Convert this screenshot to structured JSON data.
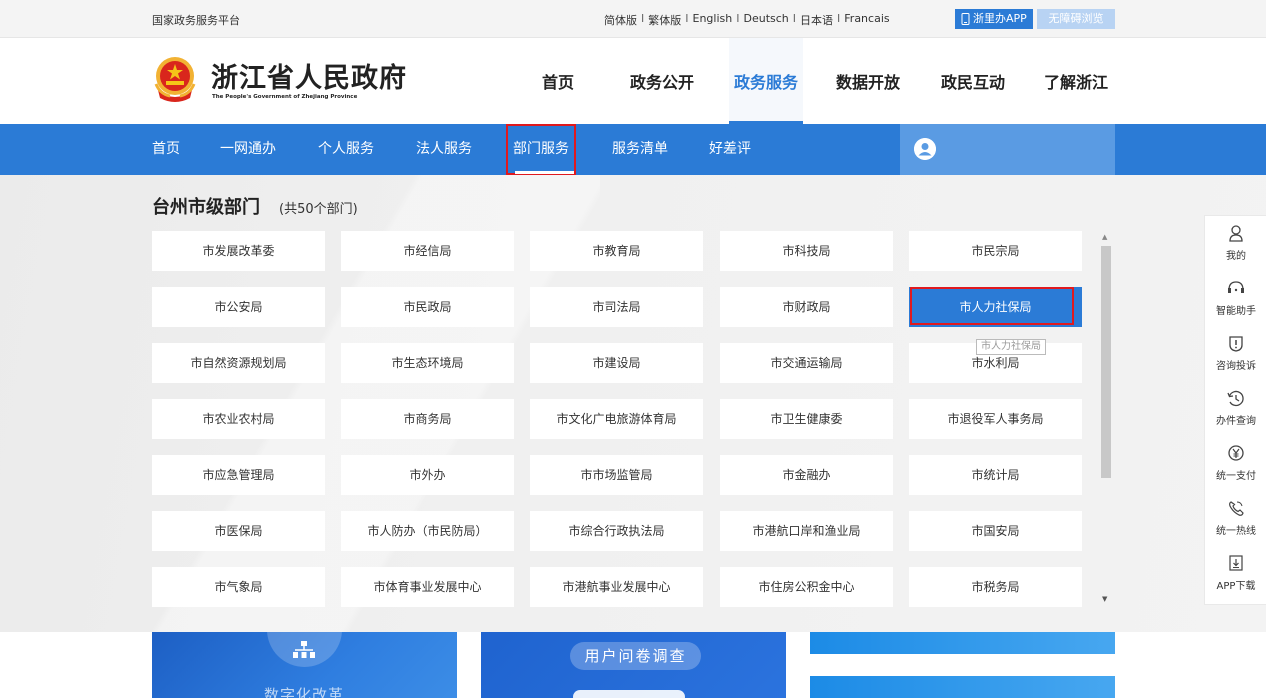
{
  "topbar": {
    "platform": "国家政务服务平台",
    "languages": [
      "简体版",
      "繁体版",
      "English",
      "Deutsch",
      "日本语",
      "Francais"
    ],
    "separator": "I",
    "app_button": "浙里办APP",
    "accessibility_button": "无障碍浏览"
  },
  "header": {
    "logo_cn": "浙江省人民政府",
    "logo_en": "The People's Government of Zhejiang Province",
    "nav": [
      "首页",
      "政务公开",
      "政务服务",
      "数据开放",
      "政民互动",
      "了解浙江"
    ],
    "active_nav": "政务服务"
  },
  "subnav": {
    "items": [
      "首页",
      "一网通办",
      "个人服务",
      "法人服务",
      "部门服务",
      "服务清单",
      "好差评"
    ],
    "highlighted": "部门服务"
  },
  "panel": {
    "title": "台州市级部门",
    "count": "(共50个部门)",
    "departments": [
      [
        "市发展改革委",
        "市经信局",
        "市教育局",
        "市科技局",
        "市民宗局"
      ],
      [
        "市公安局",
        "市民政局",
        "市司法局",
        "市财政局",
        "市人力社保局"
      ],
      [
        "市自然资源规划局",
        "市生态环境局",
        "市建设局",
        "市交通运输局",
        "市水利局"
      ],
      [
        "市农业农村局",
        "市商务局",
        "市文化广电旅游体育局",
        "市卫生健康委",
        "市退役军人事务局"
      ],
      [
        "市应急管理局",
        "市外办",
        "市市场监管局",
        "市金融办",
        "市统计局"
      ],
      [
        "市医保局",
        "市人防办（市民防局）",
        "市综合行政执法局",
        "市港航口岸和渔业局",
        "市国安局"
      ],
      [
        "市气象局",
        "市体育事业发展中心",
        "市港航事业发展中心",
        "市住房公积金中心",
        "市税务局"
      ]
    ],
    "selected": "市人力社保局",
    "tooltip": "市人力社保局"
  },
  "right_toolbar": [
    {
      "label": "我的",
      "icon": "user-icon"
    },
    {
      "label": "智能助手",
      "icon": "assistant-icon"
    },
    {
      "label": "咨询投诉",
      "icon": "complaint-icon"
    },
    {
      "label": "办件查询",
      "icon": "history-icon"
    },
    {
      "label": "统一支付",
      "icon": "yuan-icon"
    },
    {
      "label": "统一热线",
      "icon": "phone-icon"
    },
    {
      "label": "APP下载",
      "icon": "download-icon"
    }
  ],
  "cards": {
    "digital_reform": "数字化改革",
    "survey": "用户问卷调查"
  },
  "colors": {
    "primary": "#2b7bd6",
    "highlight": "#e0191e",
    "subnav_user": "#5a9be3"
  }
}
